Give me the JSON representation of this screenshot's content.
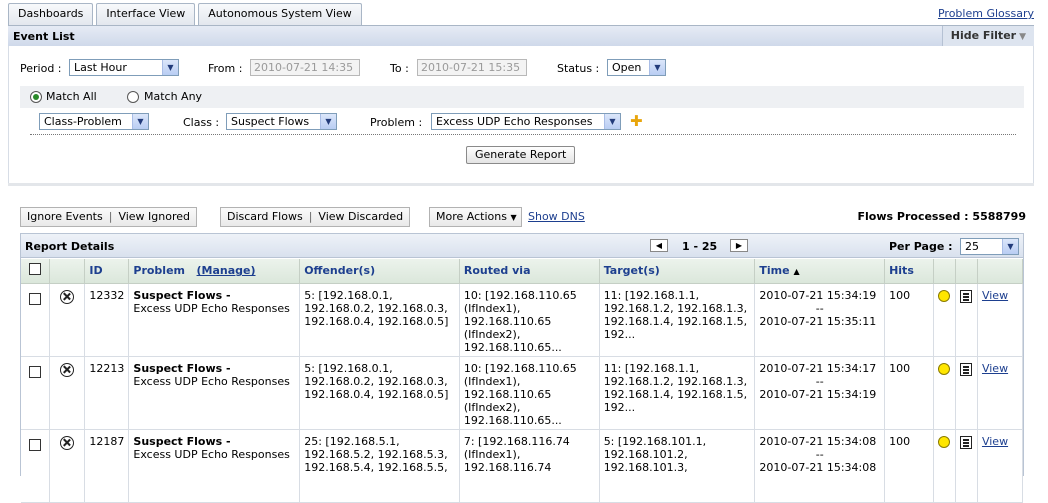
{
  "tabs": [
    "Dashboards",
    "Interface View",
    "Autonomous System View"
  ],
  "glossary_link": "Problem Glossary",
  "event_list": {
    "title": "Event List",
    "hide_filter": "Hide Filter"
  },
  "filter": {
    "period_label": "Period :",
    "period_value": "Last Hour",
    "from_label": "From :",
    "from_value": "2010-07-21 14:35",
    "to_label": "To :",
    "to_value": "2010-07-21 15:35",
    "status_label": "Status :",
    "status_value": "Open",
    "match_all": "Match All",
    "match_any": "Match Any",
    "criteria_value": "Class-Problem",
    "class_label": "Class :",
    "class_value": "Suspect Flows",
    "problem_label": "Problem :",
    "problem_value": "Excess UDP Echo Responses",
    "generate_report": "Generate Report"
  },
  "actions": {
    "ignore_events": "Ignore Events",
    "view_ignored": "View Ignored",
    "discard_flows": "Discard Flows",
    "view_discarded": "View Discarded",
    "more_actions": "More Actions",
    "show_dns": "Show DNS",
    "flows_processed": "Flows Processed : 5588799"
  },
  "report": {
    "title": "Report Details",
    "page_range": "1 - 25",
    "per_page_label": "Per Page :",
    "per_page_value": "25",
    "columns": {
      "id": "ID",
      "problem": "Problem",
      "manage": "(Manage)",
      "offenders": "Offender(s)",
      "routed_via": "Routed via",
      "targets": "Target(s)",
      "time": "Time",
      "hits": "Hits"
    },
    "rows": [
      {
        "id": "12332",
        "class": "Suspect Flows -",
        "problem": "Excess UDP Echo Responses",
        "offenders": [
          "5: [192.168.0.1,",
          "192.168.0.2, 192.168.0.3,",
          "192.168.0.4, 192.168.0.5]"
        ],
        "routed": [
          "10: [192.168.110.65",
          "(IfIndex1),",
          "192.168.110.65",
          "(IfIndex2),",
          "192.168.110.65..."
        ],
        "targets": [
          "11: [192.168.1.1,",
          "192.168.1.2, 192.168.1.3,",
          "192.168.1.4, 192.168.1.5,",
          "192..."
        ],
        "time_start": "2010-07-21 15:34:19",
        "time_sep": "--",
        "time_end": "2010-07-21 15:35:11",
        "hits": "100",
        "view": "View"
      },
      {
        "id": "12213",
        "class": "Suspect Flows -",
        "problem": "Excess UDP Echo Responses",
        "offenders": [
          "5: [192.168.0.1,",
          "192.168.0.2, 192.168.0.3,",
          "192.168.0.4, 192.168.0.5]"
        ],
        "routed": [
          "10: [192.168.110.65",
          "(IfIndex1),",
          "192.168.110.65",
          "(IfIndex2),",
          "192.168.110.65..."
        ],
        "targets": [
          "11: [192.168.1.1,",
          "192.168.1.2, 192.168.1.3,",
          "192.168.1.4, 192.168.1.5,",
          "192..."
        ],
        "time_start": "2010-07-21 15:34:17",
        "time_sep": "--",
        "time_end": "2010-07-21 15:34:19",
        "hits": "100",
        "view": "View"
      },
      {
        "id": "12187",
        "class": "Suspect Flows -",
        "problem": "Excess UDP Echo Responses",
        "offenders": [
          "25: [192.168.5.1,",
          "192.168.5.2, 192.168.5.3,",
          "192.168.5.4, 192.168.5.5,"
        ],
        "routed": [
          "7: [192.168.116.74",
          "(IfIndex1),",
          "192.168.116.74"
        ],
        "targets": [
          "5: [192.168.101.1,",
          "192.168.101.2,",
          "192.168.101.3,"
        ],
        "time_start": "2010-07-21 15:34:08",
        "time_sep": "--",
        "time_end": "2010-07-21 15:34:08",
        "hits": "100",
        "view": "View"
      }
    ]
  }
}
